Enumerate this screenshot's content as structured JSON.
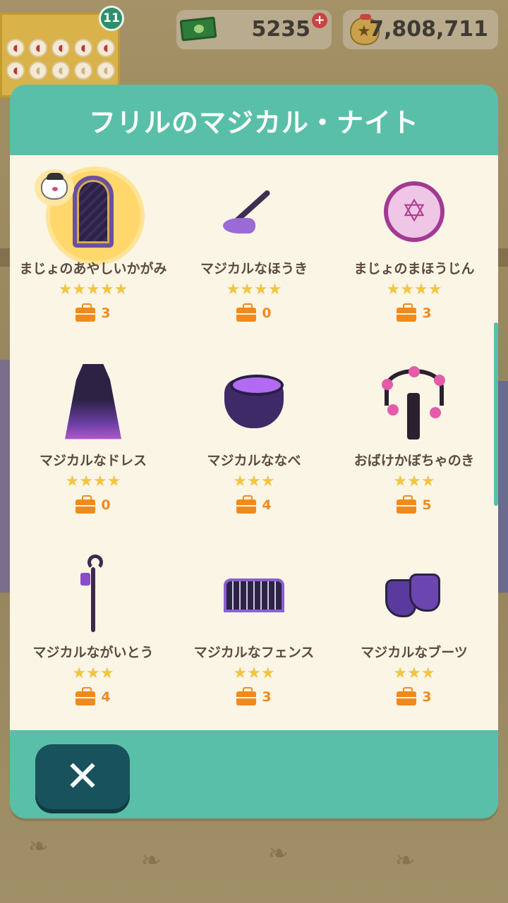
{
  "currency": {
    "tickets": "5235",
    "bells": "7,808,711"
  },
  "event": {
    "badge": "11"
  },
  "modal": {
    "title": "フリルのマジカル・ナイト",
    "items": [
      {
        "name": "まじょのあやしいかがみ",
        "stars": "★★★★★",
        "rarity": 5,
        "count": "3",
        "icon": "mirror-icon",
        "featured": true
      },
      {
        "name": "マジカルなほうき",
        "stars": "★★★★",
        "rarity": 4,
        "count": "0",
        "icon": "broom-icon"
      },
      {
        "name": "まじょのまほうじん",
        "stars": "★★★★",
        "rarity": 4,
        "count": "3",
        "icon": "magic-circle-icon"
      },
      {
        "name": "マジカルなドレス",
        "stars": "★★★★",
        "rarity": 4,
        "count": "0",
        "icon": "dress-icon"
      },
      {
        "name": "マジカルななべ",
        "stars": "★★★",
        "rarity": 3,
        "count": "4",
        "icon": "cauldron-icon"
      },
      {
        "name": "おばけかぼちゃのき",
        "stars": "★★★",
        "rarity": 3,
        "count": "5",
        "icon": "pumpkin-tree-icon"
      },
      {
        "name": "マジカルながいとう",
        "stars": "★★★",
        "rarity": 3,
        "count": "4",
        "icon": "street-lamp-icon"
      },
      {
        "name": "マジカルなフェンス",
        "stars": "★★★",
        "rarity": 3,
        "count": "3",
        "icon": "fence-icon"
      },
      {
        "name": "マジカルなブーツ",
        "stars": "★★★",
        "rarity": 3,
        "count": "3",
        "icon": "boots-icon"
      }
    ],
    "close_label": "✕"
  },
  "colors": {
    "teal": "#5abfa8",
    "dark_teal": "#18525c",
    "cream": "#fbf5e6",
    "star": "#f2c541",
    "count_orange": "#f08a1d"
  }
}
